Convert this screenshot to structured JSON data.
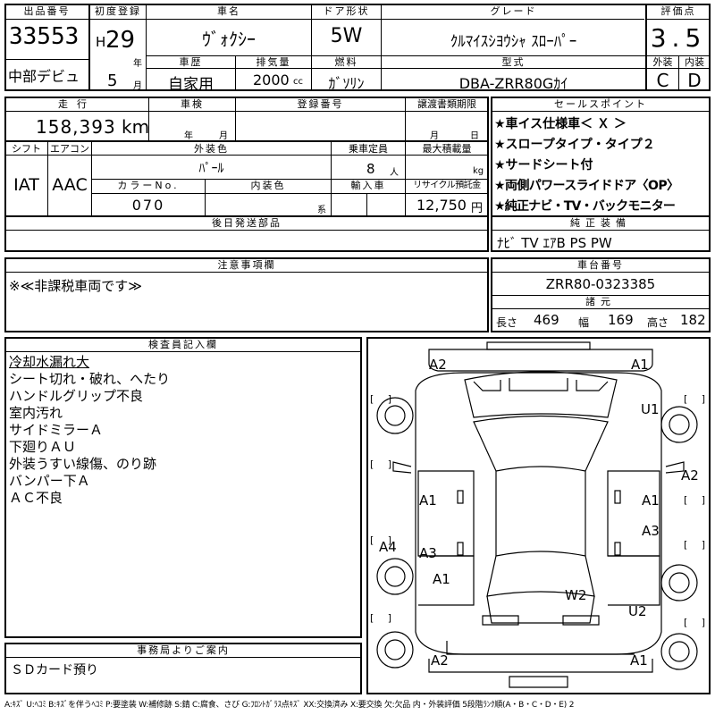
{
  "header": {
    "lot_no_label": "出品番号",
    "lot_no": "33553",
    "debut": "中部デビュ",
    "first_reg_label": "初度登録",
    "era": "H",
    "year": "29",
    "year_unit": "年",
    "month": "5",
    "month_unit": "月",
    "car_name_label": "車名",
    "car_name": "ｳﾞｫｸｼｰ",
    "door_label": "ドア形状",
    "door": "5W",
    "grade_label": "グレード",
    "grade": "ｸﾙﾏｲｽｼﾖｳｼｬ ｽﾛｰﾊﾟｰ",
    "score_label": "評価点",
    "score": "3.5",
    "history_label": "車歴",
    "history": "自家用",
    "displacement_label": "排気量",
    "displacement": "2000",
    "displacement_unit": "cc",
    "fuel_label": "燃料",
    "fuel": "ｶﾞｿﾘﾝ",
    "model_label": "型式",
    "model": "DBA-ZRR80Gｶｲ",
    "ext_label": "外装",
    "ext": "C",
    "int_label": "内装",
    "int": "D"
  },
  "row2": {
    "mileage_label": "走行",
    "mileage": "158,393",
    "mileage_unit": "km",
    "inspection_label": "車検",
    "insp_year_unit": "年",
    "insp_month_unit": "月",
    "reg_no_label": "登録番号",
    "transfer_label": "譲渡書類期限",
    "transfer_month_unit": "月",
    "transfer_day_unit": "日",
    "shift_label": "シフト",
    "shift": "IAT",
    "ac_label": "エアコン",
    "ac": "AAC",
    "exterior_color_label": "外装色",
    "exterior_color": "ﾊﾟｰﾙ",
    "capacity_label": "乗車定員",
    "capacity": "8",
    "capacity_unit": "人",
    "max_load_label": "最大積載量",
    "max_load_unit": "kg",
    "color_no_label": "カラーNo.",
    "color_no": "070",
    "interior_color_label": "内装色",
    "interior_color_unit": "系",
    "import_label": "輸入車",
    "recycle_label": "リサイクル預託金",
    "recycle": "12,750",
    "recycle_unit": "円",
    "later_parts_label": "後日発送部品"
  },
  "sales_points": {
    "label": "セールスポイント",
    "items": [
      "★車イス仕様車＜ Ｘ ＞",
      "★スロープタイプ・タイプ２",
      "★サードシート付",
      "★両側パワースライドドア〈OP〉",
      "★純正ナビ・TV・バックモニター"
    ]
  },
  "equipment": {
    "label": "純正装備",
    "value": "ﾅﾋﾞ TV ｴｱB PS PW"
  },
  "caution": {
    "label": "注意事項欄",
    "value": "※≪非課税車両です≫"
  },
  "chassis": {
    "label": "車台番号",
    "value": "ZRR80-0323385",
    "dims_label": "諸元",
    "length_label": "長さ",
    "length": "469",
    "width_label": "幅",
    "width": "169",
    "height_label": "高さ",
    "height": "182"
  },
  "inspector": {
    "label": "検査員記入欄",
    "notes": [
      "冷却水漏れ大",
      "シート切れ・破れ、へたり",
      "ハンドルグリップ不良",
      "室内汚れ",
      "サイドミラーＡ",
      "下廻りＡＵ",
      "外装うすい線傷、のり跡",
      "バンパー下Ａ",
      "ＡＣ不良"
    ]
  },
  "diagram": {
    "bracket": "[ ]",
    "marks": {
      "front_left": "A2",
      "front_right": "A1",
      "fender_right": "U1",
      "door_right_front": "A2",
      "left_front_door": "A1",
      "right_front_door": "A1",
      "left_rear_quarter": "A4",
      "left_rear_door": "A3",
      "right_rear_door": "A3",
      "left_rear_fender": "A1",
      "rear_glass": "W2",
      "right_rear_fender": "U2",
      "rear_left": "A2",
      "rear_right": "A1"
    }
  },
  "office": {
    "label": "事務局よりご案内",
    "value": "ＳＤカード預り"
  },
  "footer": "A:ｷｽﾞ U:ﾍｺﾐ B:ｷｽﾞを伴うﾍｺﾐ P:要塗装 W:補修跡 S:錆 C:腐食、さび G:ﾌﾛﾝﾄｶﾞﾗｽ点ｷｽﾞ XX:交換済み X:要交換 欠:欠品 内・外装評価 5段階ﾗﾝｸ順(A・B・C・D・E) 2"
}
